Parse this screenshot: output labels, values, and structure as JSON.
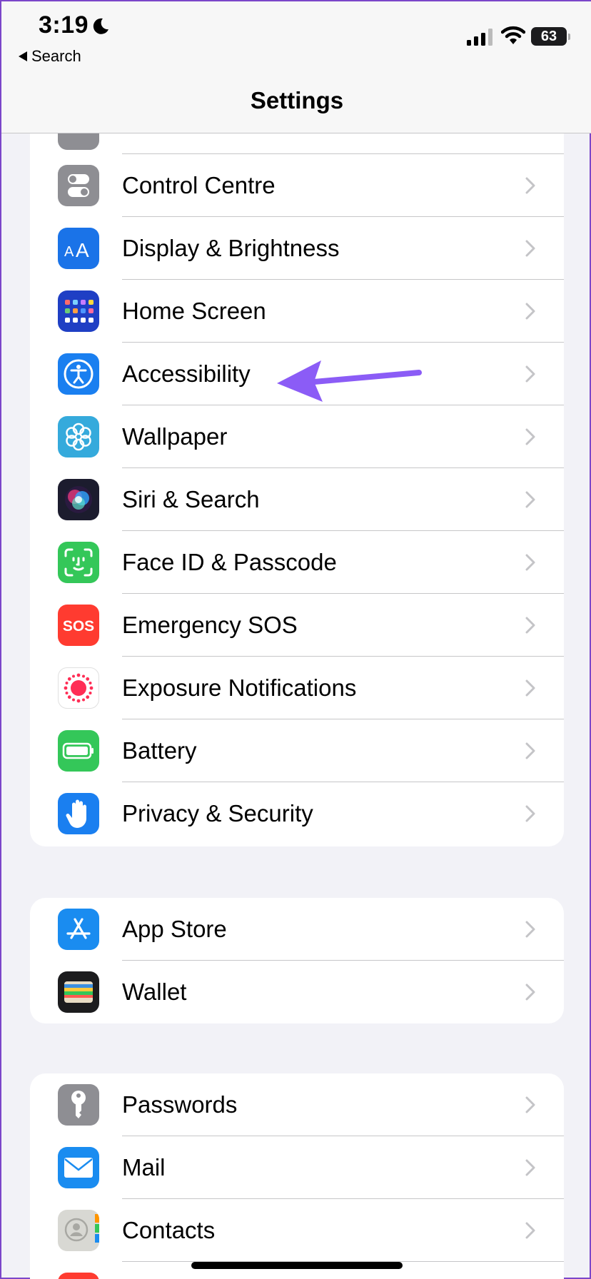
{
  "status_bar": {
    "time": "3:19",
    "battery": "63"
  },
  "nav": {
    "back_label": "Search",
    "title": "Settings"
  },
  "groups": [
    {
      "items": [
        {
          "label": "Control Centre",
          "icon": "control-centre-icon",
          "color": "#8e8e93"
        },
        {
          "label": "Display & Brightness",
          "icon": "display-brightness-icon",
          "color": "#1a73e8"
        },
        {
          "label": "Home Screen",
          "icon": "home-screen-icon",
          "color": "#1f3fc4"
        },
        {
          "label": "Accessibility",
          "icon": "accessibility-icon",
          "color": "#1a7ff0"
        },
        {
          "label": "Wallpaper",
          "icon": "wallpaper-icon",
          "color": "#35aadc"
        },
        {
          "label": "Siri & Search",
          "icon": "siri-icon",
          "color": "#1c1c2e"
        },
        {
          "label": "Face ID & Passcode",
          "icon": "face-id-icon",
          "color": "#34c759"
        },
        {
          "label": "Emergency SOS",
          "icon": "sos-icon",
          "color": "#ff3b30"
        },
        {
          "label": "Exposure Notifications",
          "icon": "exposure-icon",
          "color": "#ffffff"
        },
        {
          "label": "Battery",
          "icon": "battery-icon",
          "color": "#34c759"
        },
        {
          "label": "Privacy & Security",
          "icon": "privacy-hand-icon",
          "color": "#1a7ff0"
        }
      ]
    },
    {
      "items": [
        {
          "label": "App Store",
          "icon": "app-store-icon",
          "color": "#1a8cf0"
        },
        {
          "label": "Wallet",
          "icon": "wallet-icon",
          "color": "#1c1c1e"
        }
      ]
    },
    {
      "items": [
        {
          "label": "Passwords",
          "icon": "key-icon",
          "color": "#8e8e93"
        },
        {
          "label": "Mail",
          "icon": "mail-icon",
          "color": "#1a8cf0"
        },
        {
          "label": "Contacts",
          "icon": "contacts-icon",
          "color": "#d8d8d3"
        }
      ]
    }
  ],
  "annotation_color": "#8b5cf6"
}
